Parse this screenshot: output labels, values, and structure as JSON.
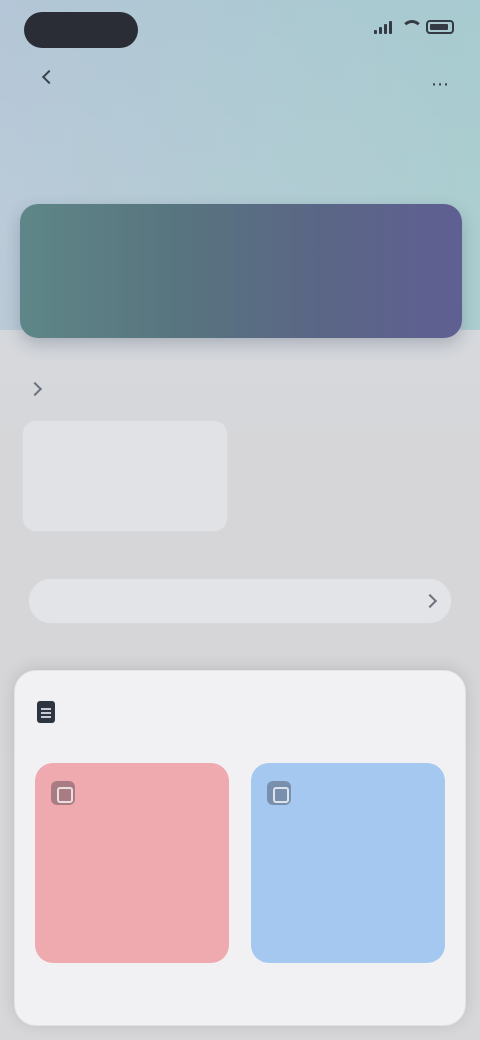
{
  "status": {
    "time": ""
  },
  "nav": {
    "back_label": ""
  },
  "page": {
    "title": ""
  },
  "hero": {
    "line1": "",
    "line2": "",
    "line3": ""
  },
  "section": {
    "title": ""
  },
  "stat": {
    "label": "",
    "value": ""
  },
  "action": {
    "label": ""
  },
  "sheet": {
    "title": "",
    "link": "",
    "tiles": [
      {
        "title": "",
        "subtitle": ""
      },
      {
        "title": "",
        "subtitle": ""
      }
    ]
  },
  "colors": {
    "hero_gradient": [
      "#5e8688",
      "#5f5f92"
    ],
    "tile_left": "#efaab0",
    "tile_right": "#a4c8f0",
    "accent": "#4f5b93"
  },
  "icons": {
    "status": [
      "signal-icon",
      "wifi-icon",
      "battery-icon"
    ],
    "nav": [
      "chevron-left-icon",
      "more-icon"
    ],
    "section": "chevron-right-icon",
    "action": "chevron-right-icon",
    "sheet": "doc-icon"
  }
}
